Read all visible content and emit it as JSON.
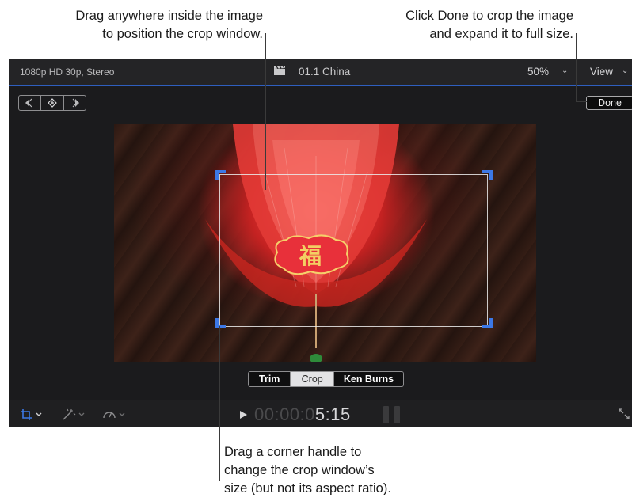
{
  "callouts": {
    "top_left": "Drag anywhere inside the image\nto position the crop window.",
    "top_right": "Click Done to crop the image\nand expand it to full size.",
    "bottom": "Drag a corner handle to\nchange the crop window’s\nsize (but not its aspect ratio)."
  },
  "viewer": {
    "format": "1080p HD 30p, Stereo",
    "clip_name": "01.1 China",
    "zoom": "50%",
    "view_menu": "View",
    "done_label": "Done",
    "modes": [
      {
        "label": "Trim",
        "active": false
      },
      {
        "label": "Crop",
        "active": true
      },
      {
        "label": "Ken Burns",
        "active": false
      }
    ],
    "timecode_dim": "00:00:0",
    "timecode_lit": "5:15",
    "icons": {
      "keyframe_prev": "keyframe-prev-icon",
      "keyframe_add": "keyframe-add-icon",
      "keyframe_next": "keyframe-next-icon",
      "clapper": "clapperboard-icon",
      "crop_tool": "crop-icon",
      "effects": "magic-wand-icon",
      "speed": "speedometer-icon",
      "fullscreen": "fullscreen-icon"
    },
    "colors": {
      "accent": "#3c78e6",
      "handle": "#3c78e6"
    }
  }
}
